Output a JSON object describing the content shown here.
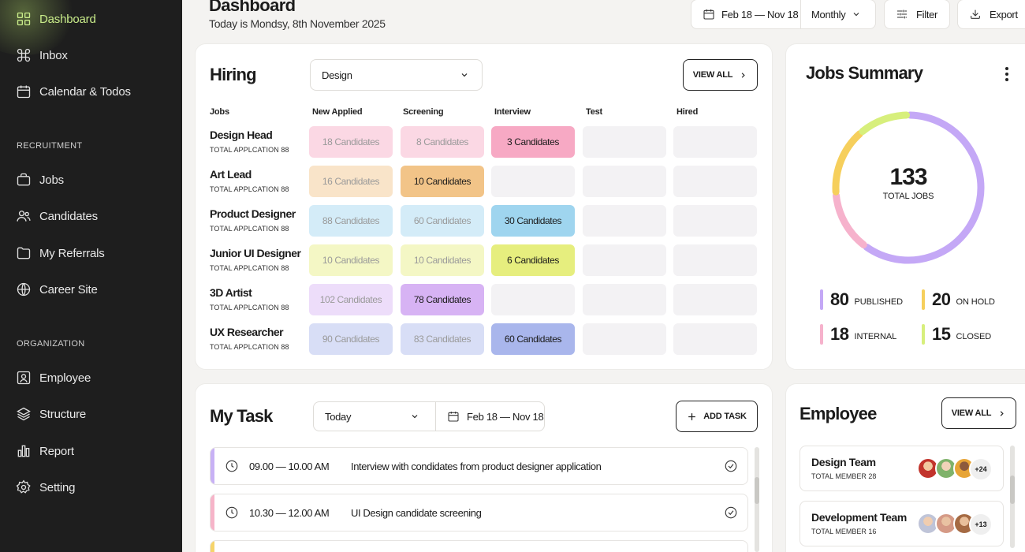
{
  "sidebar": {
    "items_main": [
      {
        "label": "Dashboard",
        "icon": "grid-icon",
        "active": true
      },
      {
        "label": "Inbox",
        "icon": "command-icon"
      },
      {
        "label": "Calendar & Todos",
        "icon": "calendar-icon"
      }
    ],
    "section_recruitment": "RECRUITMENT",
    "items_recruitment": [
      {
        "label": "Jobs",
        "icon": "briefcase-icon"
      },
      {
        "label": "Candidates",
        "icon": "users-icon"
      },
      {
        "label": "My Referrals",
        "icon": "folder-icon"
      },
      {
        "label": "Career Site",
        "icon": "globe-icon"
      }
    ],
    "section_organization": "ORGANIZATION",
    "items_organization": [
      {
        "label": "Employee",
        "icon": "user-square-icon"
      },
      {
        "label": "Structure",
        "icon": "layers-icon"
      },
      {
        "label": "Report",
        "icon": "bar-chart-icon"
      },
      {
        "label": "Setting",
        "icon": "gear-icon"
      }
    ],
    "accent": "#c9ec8a"
  },
  "header": {
    "title": "Dashboard",
    "subtitle": "Today is Mondsy, 8th November 2025",
    "date_range": "Feb 18 — Nov 18",
    "period": "Monthly",
    "filter_label": "Filter",
    "export_label": "Export"
  },
  "hiring": {
    "title": "Hiring",
    "department": "Design",
    "view_all": "VIEW ALL",
    "columns": [
      "Jobs",
      "New Applied",
      "Screening",
      "Interview",
      "Test",
      "Hired"
    ],
    "rows": [
      {
        "job": "Design Head",
        "total": "TOTAL APPLCATION 88",
        "cells": [
          "18 Candidates",
          "8 Candidates",
          "3 Candidates",
          "",
          ""
        ],
        "color": "#f7a9c4"
      },
      {
        "job": "Art Lead",
        "total": "TOTAL APPLCATION 88",
        "cells": [
          "16 Candidates",
          "10 Candidates",
          "",
          "",
          ""
        ],
        "color": "#f2c488"
      },
      {
        "job": "Product Designer",
        "total": "TOTAL APPLCATION 88",
        "cells": [
          "88 Candidates",
          "60 Candidates",
          "30 Candidates",
          "",
          ""
        ],
        "color": "#9fd5ef"
      },
      {
        "job": "Junior UI Designer",
        "total": "TOTAL APPLCATION 88",
        "cells": [
          "10 Candidates",
          "10 Candidates",
          "6 Candidates",
          "",
          ""
        ],
        "color": "#e6ee7e"
      },
      {
        "job": "3D Artist",
        "total": "TOTAL APPLCATION 88",
        "cells": [
          "102 Candidates",
          "78 Candidates",
          "",
          "",
          ""
        ],
        "color": "#d7b3f4"
      },
      {
        "job": "UX Researcher",
        "total": "TOTAL APPLCATION 88",
        "cells": [
          "90 Candidates",
          "83 Candidates",
          "60 Candidates",
          "",
          ""
        ],
        "color": "#a9b6ec"
      }
    ]
  },
  "jobs_summary": {
    "title": "Jobs Summary",
    "total": "133",
    "total_label": "TOTAL JOBS",
    "stats": [
      {
        "value": "80",
        "label": "PUBLISHED",
        "color": "#c4a8f6"
      },
      {
        "value": "20",
        "label": "ON HOLD",
        "color": "#f6cf5c"
      },
      {
        "value": "18",
        "label": "INTERNAL",
        "color": "#f6b2cc"
      },
      {
        "value": "15",
        "label": "CLOSED",
        "color": "#d7ef7c"
      }
    ]
  },
  "tasks": {
    "title": "My Task",
    "period": "Today",
    "date_range": "Feb 18 — Nov 18",
    "add_label": "ADD TASK",
    "items": [
      {
        "time": "09.00 — 10.00 AM",
        "desc": "Interview with condidates from product designer application",
        "color": "#c8b1f5"
      },
      {
        "time": "10.30 — 12.00 AM",
        "desc": "UI Design candidate screening",
        "color": "#f6b4c9"
      },
      {
        "time": "",
        "desc": "",
        "color": "#f6d46a"
      }
    ]
  },
  "employee": {
    "title": "Employee",
    "view_all": "VIEW ALL",
    "teams": [
      {
        "name": "Design Team",
        "members": "TOTAL MEMBER 28",
        "more": "+24"
      },
      {
        "name": "Development Team",
        "members": "TOTAL MEMBER 16",
        "more": "+13"
      }
    ]
  }
}
